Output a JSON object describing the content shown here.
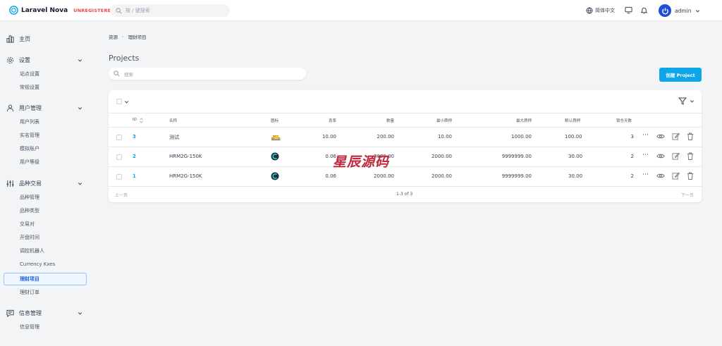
{
  "app": {
    "name": "Laravel Nova",
    "license": "UNREGISTERED"
  },
  "topbar": {
    "search_placeholder": "按 / 键搜索",
    "language": "简体中文",
    "user": "admin"
  },
  "sidebar": {
    "sections": [
      {
        "label": "主页",
        "icon": "dashboard-icon",
        "items": []
      },
      {
        "label": "设置",
        "icon": "gear-icon",
        "items": [
          "站点设置",
          "常规设置"
        ]
      },
      {
        "label": "用户管理",
        "icon": "users-icon",
        "items": [
          "用户列表",
          "实名管理",
          "模拟账户",
          "用户等级"
        ]
      },
      {
        "label": "品种交易",
        "icon": "sliders-icon",
        "items": [
          "品种管理",
          "品种类型",
          "交易对",
          "开盘时间",
          "调控机器人",
          "Currency Kxes",
          "理财项目",
          "理财订单"
        ]
      },
      {
        "label": "信息管理",
        "icon": "chat-icon",
        "items": [
          "信息管理"
        ]
      }
    ],
    "active_item": "理财项目"
  },
  "breadcrumbs": [
    "资源",
    "理财项目"
  ],
  "page": {
    "title": "Projects",
    "search_placeholder": "搜索",
    "create_label": "创建 Project"
  },
  "table": {
    "columns": [
      "ID",
      "名称",
      "图标",
      "息率",
      "数量",
      "最小质押",
      "最大质押",
      "默认质押",
      "锁仓天数"
    ],
    "rows": [
      {
        "id": "3",
        "name": "测试",
        "icon": "gold-icon",
        "rate": "10.00",
        "quantity": "200.00",
        "min": "10.00",
        "max": "1000.00",
        "default": "100.00",
        "days": "3"
      },
      {
        "id": "2",
        "name": "HRM2G-150K",
        "icon": "coin-icon",
        "rate": "0.06",
        "quantity": "2000.00",
        "min": "2000.00",
        "max": "9999999.00",
        "default": "30.00",
        "days": "2"
      },
      {
        "id": "1",
        "name": "HRM2G-150K",
        "icon": "coin-icon",
        "rate": "0.06",
        "quantity": "2000.00",
        "min": "2000.00",
        "max": "9999999.00",
        "default": "30.00",
        "days": "2"
      }
    ],
    "pagination": {
      "prev": "上一页",
      "info": "1-3 of 3",
      "next": "下一页"
    }
  },
  "watermark": "星辰源码",
  "colors": {
    "accent": "#0ea5e9",
    "brand": "#0ea5e9",
    "unregistered": "#ef4444"
  }
}
